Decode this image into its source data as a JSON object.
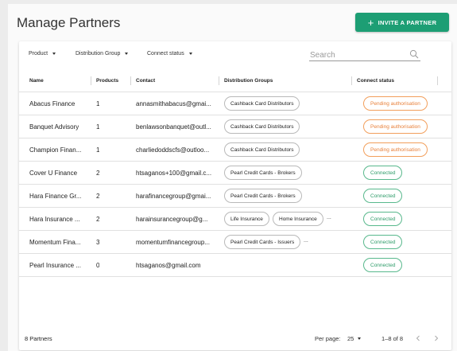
{
  "page": {
    "title": "Manage Partners"
  },
  "invite_button": {
    "icon": "plus-icon",
    "label": "INVITE A PARTNER",
    "color": "#1d9e74"
  },
  "filters": [
    {
      "label": "Product"
    },
    {
      "label": "Distribution Group"
    },
    {
      "label": "Connect status"
    }
  ],
  "search": {
    "placeholder": "Search",
    "value": ""
  },
  "columns": [
    "Name",
    "Products",
    "Contact",
    "Distribution Groups",
    "Connect status"
  ],
  "partners": [
    {
      "name": "Abacus Finance",
      "products": "1",
      "contact": "annasmithabacus@gmai...",
      "groups": [
        "Cashback Card Distributors"
      ],
      "more": "",
      "status": "Pending authorisation",
      "status_type": "pending"
    },
    {
      "name": "Banquet Advisory",
      "products": "1",
      "contact": "benlawsonbanquet@outl...",
      "groups": [
        "Cashback Card Distributors"
      ],
      "more": "",
      "status": "Pending authorisation",
      "status_type": "pending"
    },
    {
      "name": "Champion Finan...",
      "products": "1",
      "contact": "charliedoddscfs@outloo...",
      "groups": [
        "Cashback Card Distributors"
      ],
      "more": "",
      "status": "Pending authorisation",
      "status_type": "pending"
    },
    {
      "name": "Cover U Finance",
      "products": "2",
      "contact": "htsaganos+100@gmail.c...",
      "groups": [
        "Pearl Credit Cards - Brokers"
      ],
      "more": "",
      "status": "Connected",
      "status_type": "connected"
    },
    {
      "name": "Hara Finance Gr...",
      "products": "2",
      "contact": "harafinancegroup@gmai...",
      "groups": [
        "Pearl Credit Cards - Brokers"
      ],
      "more": "",
      "status": "Connected",
      "status_type": "connected"
    },
    {
      "name": "Hara Insurance ...",
      "products": "2",
      "contact": "harainsurancegroup@g...",
      "groups": [
        "Life Insurance",
        "Home Insurance"
      ],
      "more": "...",
      "status": "Connected",
      "status_type": "connected"
    },
    {
      "name": "Momentum Fina...",
      "products": "3",
      "contact": "momentumfinancegroup...",
      "groups": [
        "Pearl Credit Cards - Issuers"
      ],
      "more": "...",
      "status": "Connected",
      "status_type": "connected"
    },
    {
      "name": "Pearl Insurance ...",
      "products": "0",
      "contact": "htsaganos@gmail.com",
      "groups": [],
      "more": "",
      "status": "Connected",
      "status_type": "connected"
    }
  ],
  "footer": {
    "count": "8 Partners",
    "per_page_label": "Per page:",
    "per_page_value": "25",
    "range": "1–8 of 8"
  },
  "colors": {
    "pending": "#e8803a",
    "connected": "#2e9c69"
  }
}
